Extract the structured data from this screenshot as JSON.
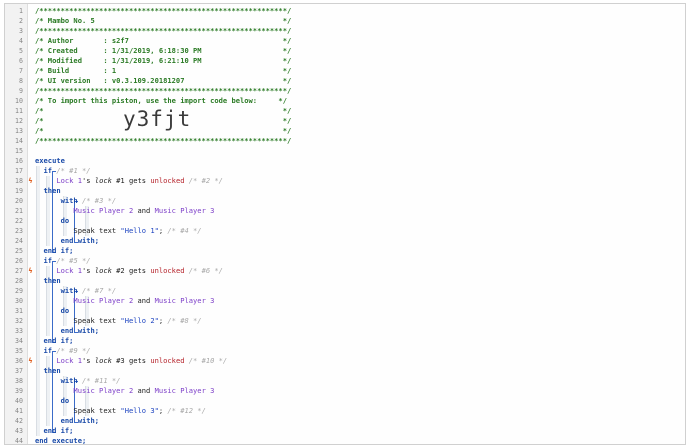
{
  "editor": {
    "lines": [
      {
        "n": "1",
        "mark": "",
        "segs": [
          {
            "t": "/**********************************************************/",
            "c": "header"
          }
        ]
      },
      {
        "n": "2",
        "mark": "",
        "segs": [
          {
            "t": "/* Mambo No. 5                                            */",
            "c": "header"
          }
        ]
      },
      {
        "n": "3",
        "mark": "",
        "segs": [
          {
            "t": "/**********************************************************/",
            "c": "header"
          }
        ]
      },
      {
        "n": "4",
        "mark": "",
        "segs": [
          {
            "t": "/* Author       : s2f7                                    */",
            "c": "header"
          }
        ]
      },
      {
        "n": "5",
        "mark": "",
        "segs": [
          {
            "t": "/* Created      : 1/31/2019, 6:18:30 PM                   */",
            "c": "header"
          }
        ]
      },
      {
        "n": "6",
        "mark": "",
        "segs": [
          {
            "t": "/* Modified     : 1/31/2019, 6:21:10 PM                   */",
            "c": "header"
          }
        ]
      },
      {
        "n": "7",
        "mark": "",
        "segs": [
          {
            "t": "/* Build        : 1                                       */",
            "c": "header"
          }
        ]
      },
      {
        "n": "8",
        "mark": "",
        "segs": [
          {
            "t": "/* UI version   : v0.3.109.20181207                       */",
            "c": "header"
          }
        ]
      },
      {
        "n": "9",
        "mark": "",
        "segs": [
          {
            "t": "/**********************************************************/",
            "c": "header"
          }
        ]
      },
      {
        "n": "10",
        "mark": "",
        "segs": [
          {
            "t": "/* To import this piston, use the import code below:     */",
            "c": "header"
          }
        ]
      },
      {
        "n": "11",
        "mark": "",
        "segs": [
          {
            "t": "/*                                                        */",
            "c": "header"
          }
        ]
      },
      {
        "n": "12",
        "mark": "",
        "big": "y3fjt",
        "segs": [
          {
            "t": "/*                                                        */",
            "c": "header"
          }
        ]
      },
      {
        "n": "13",
        "mark": "",
        "segs": [
          {
            "t": "/*                                                        */",
            "c": "header"
          }
        ]
      },
      {
        "n": "14",
        "mark": "",
        "segs": [
          {
            "t": "/**********************************************************/",
            "c": "header"
          }
        ]
      },
      {
        "n": "15",
        "mark": "",
        "segs": []
      },
      {
        "n": "16",
        "mark": "",
        "segs": [
          {
            "t": "execute",
            "c": "kw"
          }
        ]
      },
      {
        "n": "17",
        "mark": "",
        "segs": [
          {
            "t": "  if ",
            "c": "kw"
          },
          {
            "t": "/* #1 */",
            "c": "cmt"
          }
        ]
      },
      {
        "n": "18",
        "mark": "ϟ",
        "segs": [
          {
            "t": "     Lock 1",
            "c": "dev"
          },
          {
            "t": "'s ",
            "c": "plain"
          },
          {
            "t": "lock",
            "c": "attr"
          },
          {
            "t": " #1 gets ",
            "c": "plain"
          },
          {
            "t": "unlocked",
            "c": "val"
          },
          {
            "t": " /* #2 */",
            "c": "cmt"
          }
        ]
      },
      {
        "n": "19",
        "mark": "",
        "segs": [
          {
            "t": "  then",
            "c": "kw"
          }
        ]
      },
      {
        "n": "20",
        "mark": "",
        "segs": [
          {
            "t": "      with ",
            "c": "kw"
          },
          {
            "t": "/* #3 */",
            "c": "cmt"
          }
        ]
      },
      {
        "n": "21",
        "mark": "",
        "segs": [
          {
            "t": "         Music Player 2",
            "c": "dev"
          },
          {
            "t": " and ",
            "c": "plain"
          },
          {
            "t": "Music Player 3",
            "c": "dev"
          }
        ]
      },
      {
        "n": "22",
        "mark": "",
        "segs": [
          {
            "t": "      do",
            "c": "kw"
          }
        ]
      },
      {
        "n": "23",
        "mark": "",
        "segs": [
          {
            "t": "         Speak text ",
            "c": "plain"
          },
          {
            "t": "\"Hello 1\"",
            "c": "str"
          },
          {
            "t": "; ",
            "c": "plain"
          },
          {
            "t": "/* #4 */",
            "c": "cmt"
          }
        ]
      },
      {
        "n": "24",
        "mark": "",
        "segs": [
          {
            "t": "      end with;",
            "c": "kw"
          }
        ]
      },
      {
        "n": "25",
        "mark": "",
        "segs": [
          {
            "t": "  end if;",
            "c": "kw"
          }
        ]
      },
      {
        "n": "26",
        "mark": "",
        "segs": [
          {
            "t": "  if ",
            "c": "kw"
          },
          {
            "t": "/* #5 */",
            "c": "cmt"
          }
        ]
      },
      {
        "n": "27",
        "mark": "ϟ",
        "segs": [
          {
            "t": "     Lock 1",
            "c": "dev"
          },
          {
            "t": "'s ",
            "c": "plain"
          },
          {
            "t": "lock",
            "c": "attr"
          },
          {
            "t": " #2 gets ",
            "c": "plain"
          },
          {
            "t": "unlocked",
            "c": "val"
          },
          {
            "t": " /* #6 */",
            "c": "cmt"
          }
        ]
      },
      {
        "n": "28",
        "mark": "",
        "segs": [
          {
            "t": "  then",
            "c": "kw"
          }
        ]
      },
      {
        "n": "29",
        "mark": "",
        "segs": [
          {
            "t": "      with ",
            "c": "kw"
          },
          {
            "t": "/* #7 */",
            "c": "cmt"
          }
        ]
      },
      {
        "n": "30",
        "mark": "",
        "segs": [
          {
            "t": "         Music Player 2",
            "c": "dev"
          },
          {
            "t": " and ",
            "c": "plain"
          },
          {
            "t": "Music Player 3",
            "c": "dev"
          }
        ]
      },
      {
        "n": "31",
        "mark": "",
        "segs": [
          {
            "t": "      do",
            "c": "kw"
          }
        ]
      },
      {
        "n": "32",
        "mark": "",
        "segs": [
          {
            "t": "         Speak text ",
            "c": "plain"
          },
          {
            "t": "\"Hello 2\"",
            "c": "str"
          },
          {
            "t": "; ",
            "c": "plain"
          },
          {
            "t": "/* #8 */",
            "c": "cmt"
          }
        ]
      },
      {
        "n": "33",
        "mark": "",
        "segs": [
          {
            "t": "      end with;",
            "c": "kw"
          }
        ]
      },
      {
        "n": "34",
        "mark": "",
        "segs": [
          {
            "t": "  end if;",
            "c": "kw"
          }
        ]
      },
      {
        "n": "35",
        "mark": "",
        "segs": [
          {
            "t": "  if ",
            "c": "kw"
          },
          {
            "t": "/* #9 */",
            "c": "cmt"
          }
        ]
      },
      {
        "n": "36",
        "mark": "ϟ",
        "segs": [
          {
            "t": "     Lock 1",
            "c": "dev"
          },
          {
            "t": "'s ",
            "c": "plain"
          },
          {
            "t": "lock",
            "c": "attr"
          },
          {
            "t": " #3 gets ",
            "c": "plain"
          },
          {
            "t": "unlocked",
            "c": "val"
          },
          {
            "t": " /* #10 */",
            "c": "cmt"
          }
        ]
      },
      {
        "n": "37",
        "mark": "",
        "segs": [
          {
            "t": "  then",
            "c": "kw"
          }
        ]
      },
      {
        "n": "38",
        "mark": "",
        "segs": [
          {
            "t": "      with ",
            "c": "kw"
          },
          {
            "t": "/* #11 */",
            "c": "cmt"
          }
        ]
      },
      {
        "n": "39",
        "mark": "",
        "segs": [
          {
            "t": "         Music Player 2",
            "c": "dev"
          },
          {
            "t": " and ",
            "c": "plain"
          },
          {
            "t": "Music Player 3",
            "c": "dev"
          }
        ]
      },
      {
        "n": "40",
        "mark": "",
        "segs": [
          {
            "t": "      do",
            "c": "kw"
          }
        ]
      },
      {
        "n": "41",
        "mark": "",
        "segs": [
          {
            "t": "         Speak text ",
            "c": "plain"
          },
          {
            "t": "\"Hello 3\"",
            "c": "str"
          },
          {
            "t": "; ",
            "c": "plain"
          },
          {
            "t": "/* #12 */",
            "c": "cmt"
          }
        ]
      },
      {
        "n": "42",
        "mark": "",
        "segs": [
          {
            "t": "      end with;",
            "c": "kw"
          }
        ]
      },
      {
        "n": "43",
        "mark": "",
        "segs": [
          {
            "t": "  end if;",
            "c": "kw"
          }
        ]
      },
      {
        "n": "44",
        "mark": "",
        "segs": [
          {
            "t": "end execute;",
            "c": "kw"
          }
        ]
      }
    ]
  },
  "colors": {
    "header": "#2a7a24",
    "keyword": "#1a4aa8",
    "comment": "#a8a8a8",
    "device": "#7d3fc8",
    "string": "#1d44c0",
    "value": "#b5222a",
    "trigger_mark": "#e06020"
  },
  "icons": {
    "trigger_mark": "lightning-bolt-icon"
  }
}
